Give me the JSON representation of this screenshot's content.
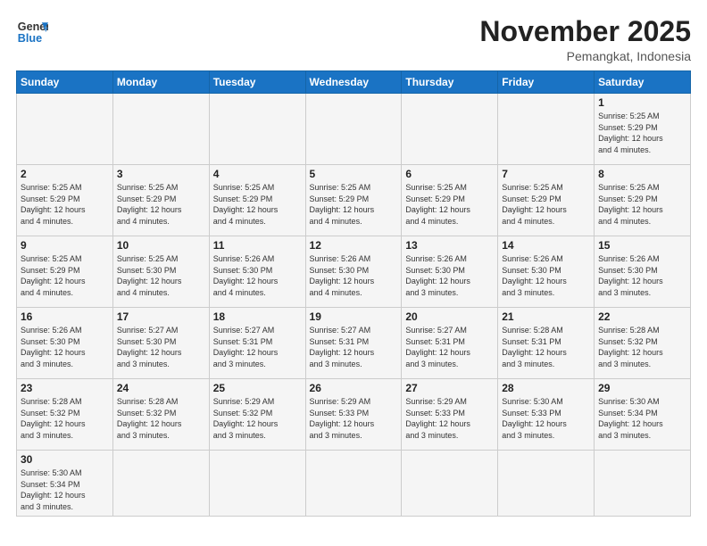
{
  "logo": {
    "line1": "General",
    "line2": "Blue"
  },
  "title": "November 2025",
  "location": "Pemangkat, Indonesia",
  "days_of_week": [
    "Sunday",
    "Monday",
    "Tuesday",
    "Wednesday",
    "Thursday",
    "Friday",
    "Saturday"
  ],
  "weeks": [
    [
      {
        "day": "",
        "info": ""
      },
      {
        "day": "",
        "info": ""
      },
      {
        "day": "",
        "info": ""
      },
      {
        "day": "",
        "info": ""
      },
      {
        "day": "",
        "info": ""
      },
      {
        "day": "",
        "info": ""
      },
      {
        "day": "1",
        "info": "Sunrise: 5:25 AM\nSunset: 5:29 PM\nDaylight: 12 hours\nand 4 minutes."
      }
    ],
    [
      {
        "day": "2",
        "info": "Sunrise: 5:25 AM\nSunset: 5:29 PM\nDaylight: 12 hours\nand 4 minutes."
      },
      {
        "day": "3",
        "info": "Sunrise: 5:25 AM\nSunset: 5:29 PM\nDaylight: 12 hours\nand 4 minutes."
      },
      {
        "day": "4",
        "info": "Sunrise: 5:25 AM\nSunset: 5:29 PM\nDaylight: 12 hours\nand 4 minutes."
      },
      {
        "day": "5",
        "info": "Sunrise: 5:25 AM\nSunset: 5:29 PM\nDaylight: 12 hours\nand 4 minutes."
      },
      {
        "day": "6",
        "info": "Sunrise: 5:25 AM\nSunset: 5:29 PM\nDaylight: 12 hours\nand 4 minutes."
      },
      {
        "day": "7",
        "info": "Sunrise: 5:25 AM\nSunset: 5:29 PM\nDaylight: 12 hours\nand 4 minutes."
      },
      {
        "day": "8",
        "info": "Sunrise: 5:25 AM\nSunset: 5:29 PM\nDaylight: 12 hours\nand 4 minutes."
      }
    ],
    [
      {
        "day": "9",
        "info": "Sunrise: 5:25 AM\nSunset: 5:29 PM\nDaylight: 12 hours\nand 4 minutes."
      },
      {
        "day": "10",
        "info": "Sunrise: 5:25 AM\nSunset: 5:30 PM\nDaylight: 12 hours\nand 4 minutes."
      },
      {
        "day": "11",
        "info": "Sunrise: 5:26 AM\nSunset: 5:30 PM\nDaylight: 12 hours\nand 4 minutes."
      },
      {
        "day": "12",
        "info": "Sunrise: 5:26 AM\nSunset: 5:30 PM\nDaylight: 12 hours\nand 4 minutes."
      },
      {
        "day": "13",
        "info": "Sunrise: 5:26 AM\nSunset: 5:30 PM\nDaylight: 12 hours\nand 3 minutes."
      },
      {
        "day": "14",
        "info": "Sunrise: 5:26 AM\nSunset: 5:30 PM\nDaylight: 12 hours\nand 3 minutes."
      },
      {
        "day": "15",
        "info": "Sunrise: 5:26 AM\nSunset: 5:30 PM\nDaylight: 12 hours\nand 3 minutes."
      }
    ],
    [
      {
        "day": "16",
        "info": "Sunrise: 5:26 AM\nSunset: 5:30 PM\nDaylight: 12 hours\nand 3 minutes."
      },
      {
        "day": "17",
        "info": "Sunrise: 5:27 AM\nSunset: 5:30 PM\nDaylight: 12 hours\nand 3 minutes."
      },
      {
        "day": "18",
        "info": "Sunrise: 5:27 AM\nSunset: 5:31 PM\nDaylight: 12 hours\nand 3 minutes."
      },
      {
        "day": "19",
        "info": "Sunrise: 5:27 AM\nSunset: 5:31 PM\nDaylight: 12 hours\nand 3 minutes."
      },
      {
        "day": "20",
        "info": "Sunrise: 5:27 AM\nSunset: 5:31 PM\nDaylight: 12 hours\nand 3 minutes."
      },
      {
        "day": "21",
        "info": "Sunrise: 5:28 AM\nSunset: 5:31 PM\nDaylight: 12 hours\nand 3 minutes."
      },
      {
        "day": "22",
        "info": "Sunrise: 5:28 AM\nSunset: 5:32 PM\nDaylight: 12 hours\nand 3 minutes."
      }
    ],
    [
      {
        "day": "23",
        "info": "Sunrise: 5:28 AM\nSunset: 5:32 PM\nDaylight: 12 hours\nand 3 minutes."
      },
      {
        "day": "24",
        "info": "Sunrise: 5:28 AM\nSunset: 5:32 PM\nDaylight: 12 hours\nand 3 minutes."
      },
      {
        "day": "25",
        "info": "Sunrise: 5:29 AM\nSunset: 5:32 PM\nDaylight: 12 hours\nand 3 minutes."
      },
      {
        "day": "26",
        "info": "Sunrise: 5:29 AM\nSunset: 5:33 PM\nDaylight: 12 hours\nand 3 minutes."
      },
      {
        "day": "27",
        "info": "Sunrise: 5:29 AM\nSunset: 5:33 PM\nDaylight: 12 hours\nand 3 minutes."
      },
      {
        "day": "28",
        "info": "Sunrise: 5:30 AM\nSunset: 5:33 PM\nDaylight: 12 hours\nand 3 minutes."
      },
      {
        "day": "29",
        "info": "Sunrise: 5:30 AM\nSunset: 5:34 PM\nDaylight: 12 hours\nand 3 minutes."
      }
    ],
    [
      {
        "day": "30",
        "info": "Sunrise: 5:30 AM\nSunset: 5:34 PM\nDaylight: 12 hours\nand 3 minutes."
      },
      {
        "day": "",
        "info": ""
      },
      {
        "day": "",
        "info": ""
      },
      {
        "day": "",
        "info": ""
      },
      {
        "day": "",
        "info": ""
      },
      {
        "day": "",
        "info": ""
      },
      {
        "day": "",
        "info": ""
      }
    ]
  ]
}
